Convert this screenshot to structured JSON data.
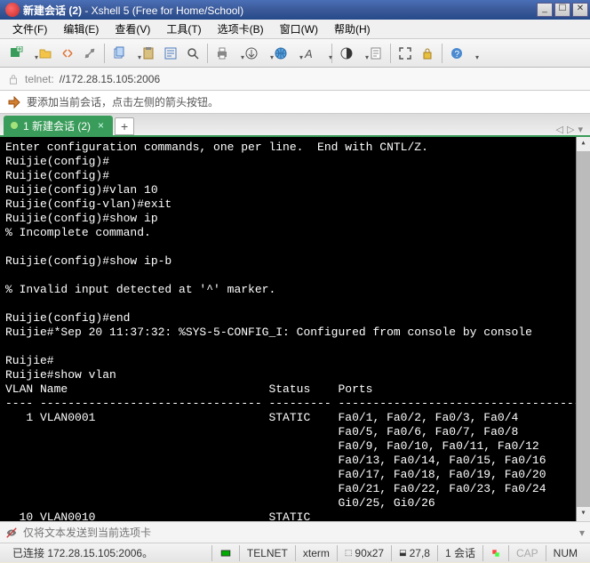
{
  "title": {
    "bold": "新建会话 (2)",
    "rest": " - Xshell 5 (Free for Home/School)"
  },
  "menus": {
    "file": "文件(F)",
    "edit": "编辑(E)",
    "view": "查看(V)",
    "tools": "工具(T)",
    "options": "选项卡(B)",
    "window": "窗口(W)",
    "help": "帮助(H)"
  },
  "address": {
    "scheme": "telnet:",
    "path": "//172.28.15.105:2006"
  },
  "hint": "要添加当前会话，点击左侧的箭头按钮。",
  "tab": {
    "label": "1 新建会话 (2)"
  },
  "terminal": {
    "lines": [
      "Enter configuration commands, one per line.  End with CNTL/Z.",
      "Ruijie(config)#",
      "Ruijie(config)#",
      "Ruijie(config)#vlan 10",
      "Ruijie(config-vlan)#exit",
      "Ruijie(config)#show ip",
      "% Incomplete command.",
      "",
      "Ruijie(config)#show ip-b",
      "",
      "% Invalid input detected at '^' marker.",
      "",
      "Ruijie(config)#end",
      "Ruijie#*Sep 20 11:37:32: %SYS-5-CONFIG_I: Configured from console by console",
      "",
      "Ruijie#",
      "Ruijie#show vlan",
      "VLAN Name                             Status    Ports",
      "---- -------------------------------- --------- -----------------------------------",
      "   1 VLAN0001                         STATIC    Fa0/1, Fa0/2, Fa0/3, Fa0/4",
      "                                                Fa0/5, Fa0/6, Fa0/7, Fa0/8",
      "                                                Fa0/9, Fa0/10, Fa0/11, Fa0/12",
      "                                                Fa0/13, Fa0/14, Fa0/15, Fa0/16",
      "                                                Fa0/17, Fa0/18, Fa0/19, Fa0/20",
      "                                                Fa0/21, Fa0/22, Fa0/23, Fa0/24",
      "                                                Gi0/25, Gi0/26",
      "  10 VLAN0010                         STATIC"
    ]
  },
  "sendbar": {
    "placeholder": "仅将文本发送到当前选项卡"
  },
  "status": {
    "conn": "已连接 172.28.15.105:2006。",
    "proto": "TELNET",
    "term": "xterm",
    "size": "90x27",
    "pos": "27,8",
    "sess": "1 会话",
    "cap": "CAP",
    "num": "NUM"
  },
  "tabs_nav": {
    "prev": "◁",
    "next": "▷",
    "menu": "▾"
  }
}
